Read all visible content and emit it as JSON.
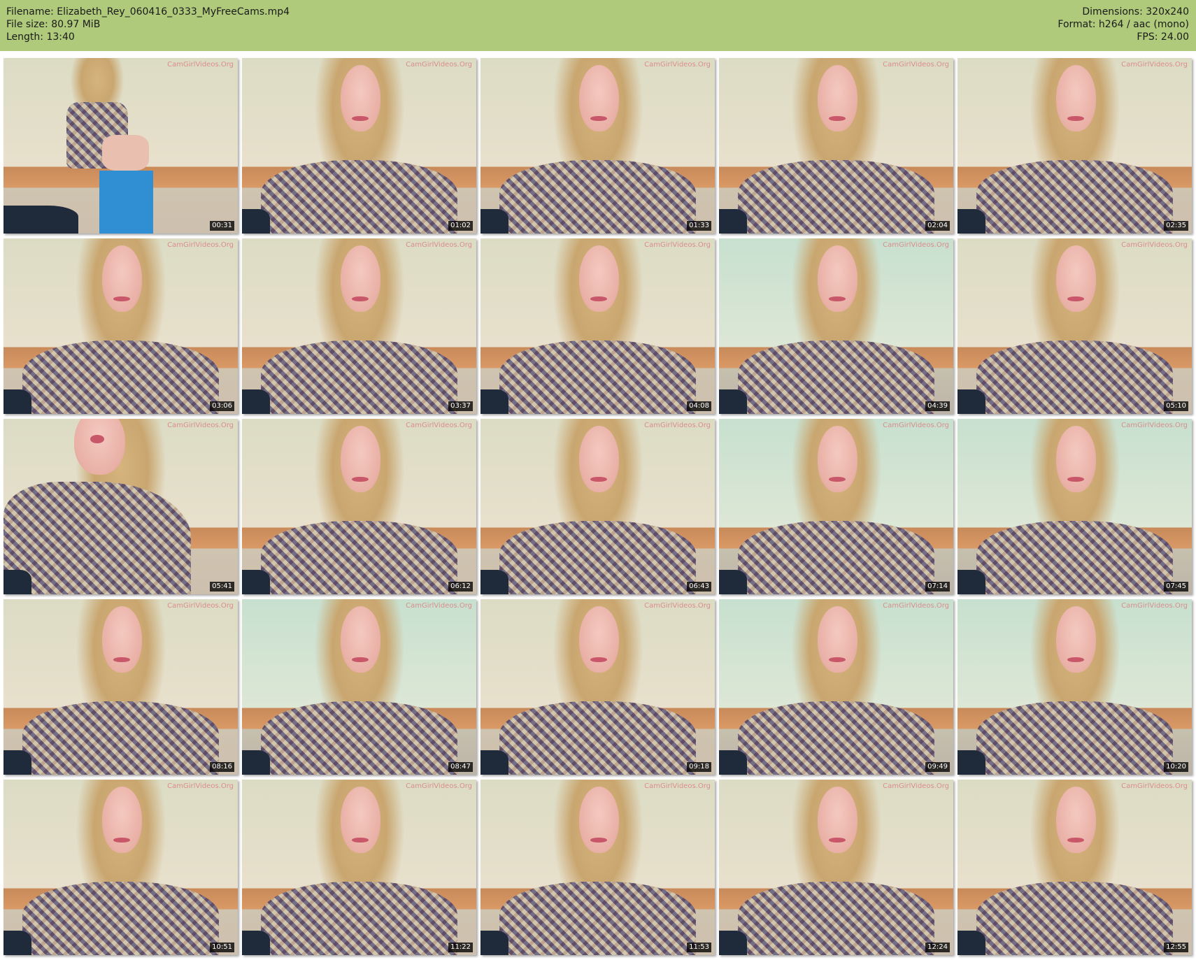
{
  "header": {
    "filename_line": "Filename: Elizabeth_Rey_060416_0333_MyFreeCams.mp4",
    "filesize_line": "File size: 80.97 MiB",
    "length_line": "Length: 13:40",
    "dimensions_line": "Dimensions: 320x240",
    "format_line": "Format: h264 / aac (mono)",
    "fps_line": "FPS: 24.00"
  },
  "colors": {
    "header_background": "#afca7b",
    "timestamp_background": "#000000",
    "timestamp_text": "#ffffff",
    "watermark_text": "#d98080"
  },
  "watermark_text": "CamGirlVideos.Org",
  "thumbnails": [
    {
      "time": "00:31"
    },
    {
      "time": "01:02"
    },
    {
      "time": "01:33"
    },
    {
      "time": "02:04"
    },
    {
      "time": "02:35"
    },
    {
      "time": "03:06"
    },
    {
      "time": "03:37"
    },
    {
      "time": "04:08"
    },
    {
      "time": "04:39"
    },
    {
      "time": "05:10"
    },
    {
      "time": "05:41"
    },
    {
      "time": "06:12"
    },
    {
      "time": "06:43"
    },
    {
      "time": "07:14"
    },
    {
      "time": "07:45"
    },
    {
      "time": "08:16"
    },
    {
      "time": "08:47"
    },
    {
      "time": "09:18"
    },
    {
      "time": "09:49"
    },
    {
      "time": "10:20"
    },
    {
      "time": "10:51"
    },
    {
      "time": "11:22"
    },
    {
      "time": "11:53"
    },
    {
      "time": "12:24"
    },
    {
      "time": "12:55"
    }
  ]
}
